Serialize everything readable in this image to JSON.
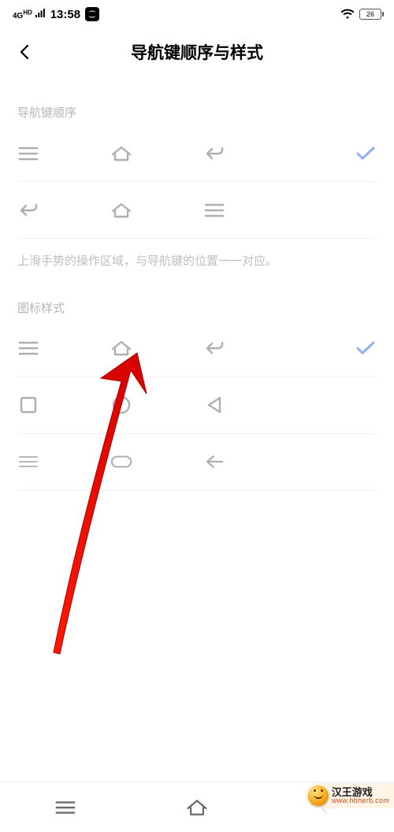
{
  "status_bar": {
    "network_label": "4G HD",
    "time": "13:58",
    "battery_text": "26"
  },
  "header": {
    "title": "导航键顺序与样式"
  },
  "section_order": {
    "label": "导航键顺序",
    "note": "上滑手势的操作区域，与导航键的位置一一对应。",
    "options": [
      {
        "icons": [
          "menu",
          "home",
          "back"
        ],
        "selected": true
      },
      {
        "icons": [
          "back",
          "home",
          "menu"
        ],
        "selected": false
      }
    ]
  },
  "section_style": {
    "label": "图标样式",
    "options": [
      {
        "icons": [
          "menu",
          "home",
          "back"
        ],
        "selected": true
      },
      {
        "icons": [
          "square",
          "circle",
          "triangle"
        ],
        "selected": false
      },
      {
        "icons": [
          "menu-thin",
          "pill",
          "arrow-left"
        ],
        "selected": false
      }
    ]
  },
  "watermark": {
    "title": "汉王游戏",
    "url": "www.hbherb.com"
  }
}
